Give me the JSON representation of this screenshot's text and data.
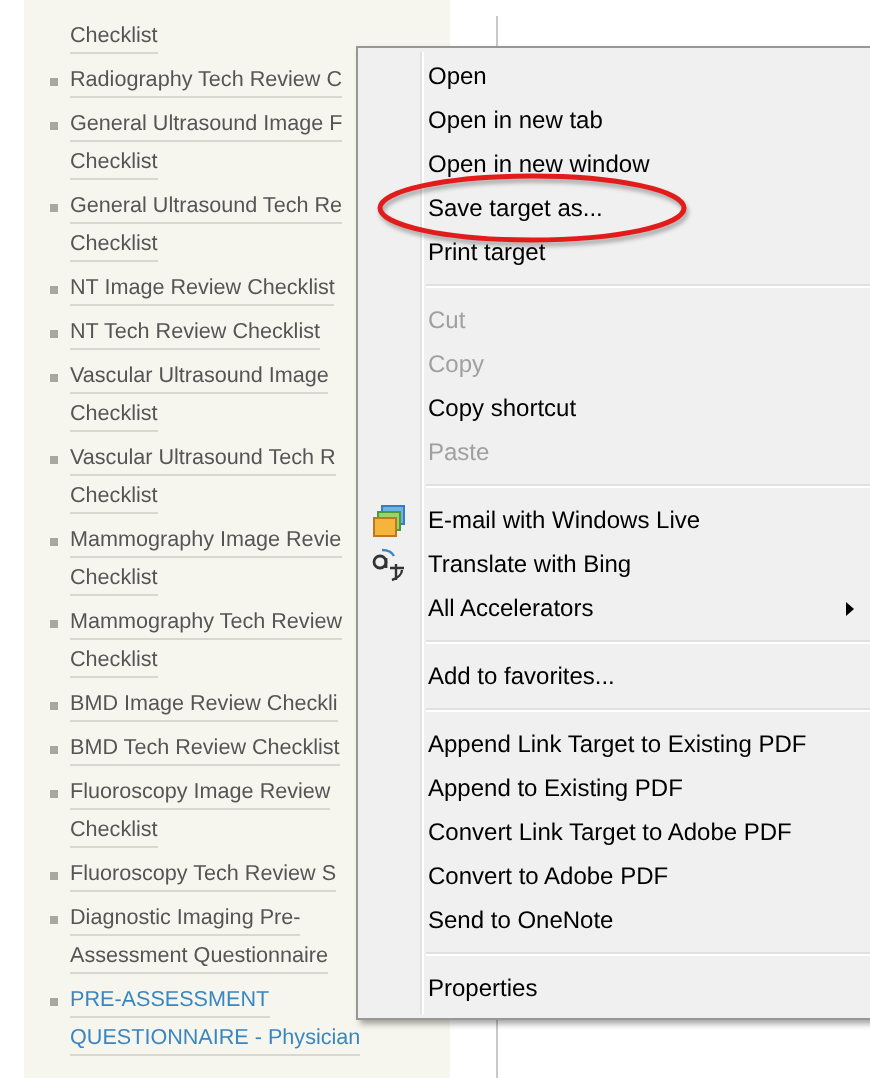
{
  "links": [
    {
      "lines": [
        "Checklist"
      ],
      "continued": true,
      "current": false
    },
    {
      "lines": [
        "Radiography Tech Review C"
      ],
      "continued": false,
      "current": false
    },
    {
      "lines": [
        "General Ultrasound Image F",
        "Checklist"
      ],
      "continued": false,
      "current": false
    },
    {
      "lines": [
        "General Ultrasound Tech Re",
        "Checklist"
      ],
      "continued": false,
      "current": false
    },
    {
      "lines": [
        "NT Image Review Checklist"
      ],
      "continued": false,
      "current": false
    },
    {
      "lines": [
        "NT Tech Review Checklist"
      ],
      "continued": false,
      "current": false
    },
    {
      "lines": [
        "Vascular Ultrasound Image",
        "Checklist"
      ],
      "continued": false,
      "current": false
    },
    {
      "lines": [
        "Vascular Ultrasound Tech R",
        "Checklist"
      ],
      "continued": false,
      "current": false
    },
    {
      "lines": [
        "Mammography Image Revie",
        "Checklist"
      ],
      "continued": false,
      "current": false
    },
    {
      "lines": [
        "Mammography Tech Review",
        "Checklist"
      ],
      "continued": false,
      "current": false
    },
    {
      "lines": [
        "BMD Image Review Checkli"
      ],
      "continued": false,
      "current": false
    },
    {
      "lines": [
        "BMD Tech Review Checklist"
      ],
      "continued": false,
      "current": false
    },
    {
      "lines": [
        "Fluoroscopy Image Review",
        "Checklist"
      ],
      "continued": false,
      "current": false
    },
    {
      "lines": [
        "Fluoroscopy Tech Review S"
      ],
      "continued": false,
      "current": false
    },
    {
      "lines": [
        "Diagnostic Imaging Pre-",
        "Assessment Questionnaire"
      ],
      "continued": false,
      "current": false
    },
    {
      "lines": [
        "PRE-ASSESSMENT",
        "QUESTIONNAIRE - Physician"
      ],
      "continued": false,
      "current": true
    }
  ],
  "context_menu": {
    "groups": [
      [
        {
          "label": "Open",
          "disabled": false,
          "highlighted": false,
          "submenu": false
        },
        {
          "label": "Open in new tab",
          "disabled": false,
          "highlighted": false,
          "submenu": false
        },
        {
          "label": "Open in new window",
          "disabled": false,
          "highlighted": false,
          "submenu": false
        },
        {
          "label": "Save target as...",
          "disabled": false,
          "highlighted": true,
          "submenu": false
        },
        {
          "label": "Print target",
          "disabled": false,
          "highlighted": false,
          "submenu": false
        }
      ],
      [
        {
          "label": "Cut",
          "disabled": true,
          "highlighted": false,
          "submenu": false
        },
        {
          "label": "Copy",
          "disabled": true,
          "highlighted": false,
          "submenu": false
        },
        {
          "label": "Copy shortcut",
          "disabled": false,
          "highlighted": false,
          "submenu": false
        },
        {
          "label": "Paste",
          "disabled": true,
          "highlighted": false,
          "submenu": false
        }
      ],
      [
        {
          "label": "E-mail with Windows Live",
          "disabled": false,
          "highlighted": false,
          "submenu": false,
          "kind": "icon"
        },
        {
          "label": "Translate with Bing",
          "disabled": false,
          "highlighted": false,
          "submenu": false,
          "kind": "icon"
        },
        {
          "label": "All Accelerators",
          "disabled": false,
          "highlighted": false,
          "submenu": true
        }
      ],
      [
        {
          "label": "Add to favorites...",
          "disabled": false,
          "highlighted": false,
          "submenu": false
        }
      ],
      [
        {
          "label": "Append Link Target to Existing PDF",
          "disabled": false,
          "highlighted": false,
          "submenu": false
        },
        {
          "label": "Append to Existing PDF",
          "disabled": false,
          "highlighted": false,
          "submenu": false
        },
        {
          "label": "Convert Link Target to Adobe PDF",
          "disabled": false,
          "highlighted": false,
          "submenu": false
        },
        {
          "label": "Convert to Adobe PDF",
          "disabled": false,
          "highlighted": false,
          "submenu": false
        },
        {
          "label": "Send to OneNote",
          "disabled": false,
          "highlighted": false,
          "submenu": false
        }
      ],
      [
        {
          "label": "Properties",
          "disabled": false,
          "highlighted": false,
          "submenu": false
        }
      ]
    ]
  }
}
